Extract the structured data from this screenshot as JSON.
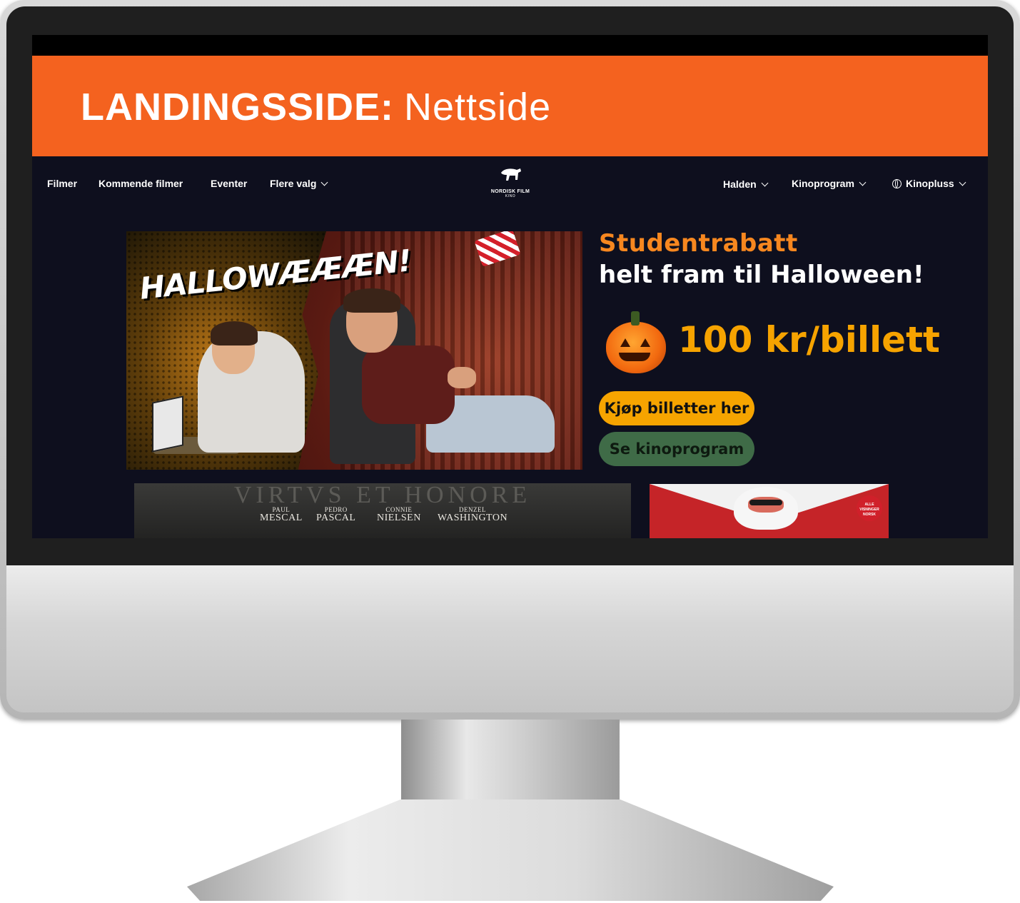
{
  "banner": {
    "title": "LANDINGSSIDE:",
    "subtitle": "Nettside"
  },
  "nav": {
    "left": [
      {
        "label": "Filmer"
      },
      {
        "label": "Kommende filmer"
      },
      {
        "label": "Eventer"
      },
      {
        "label": "Flere valg",
        "dropdown": true
      }
    ],
    "logo": {
      "name": "NORDISK FILM",
      "sub": "KINO"
    },
    "right": [
      {
        "label": "Halden",
        "dropdown": true
      },
      {
        "label": "Kinoprogram",
        "dropdown": true
      },
      {
        "label": "Kinopluss",
        "dropdown": true,
        "icon": "globe-icon"
      }
    ]
  },
  "hero": {
    "image_text": "HALLOWÆÆÆN!",
    "promo_title": "Studentrabatt",
    "promo_subtitle": "helt fram til Halloween!",
    "price": "100 kr/billett",
    "buy_button": "Kjøp billetter her",
    "program_button": "Se kinoprogram",
    "colors": {
      "orange": "#f7871f",
      "gold": "#f6a400",
      "green": "#3f6b47",
      "background": "#0e0f1e"
    }
  },
  "cards": {
    "movie": {
      "motto": "VIRTVS ET HONORE",
      "cast": [
        {
          "first": "PAUL",
          "last": "MESCAL"
        },
        {
          "first": "PEDRO",
          "last": "PASCAL"
        },
        {
          "first": "CONNIE",
          "last": "NIELSEN"
        },
        {
          "first": "DENZEL",
          "last": "WASHINGTON"
        }
      ]
    },
    "christmas": {
      "sticker": "ALLE VISNINGER NORSK"
    }
  }
}
